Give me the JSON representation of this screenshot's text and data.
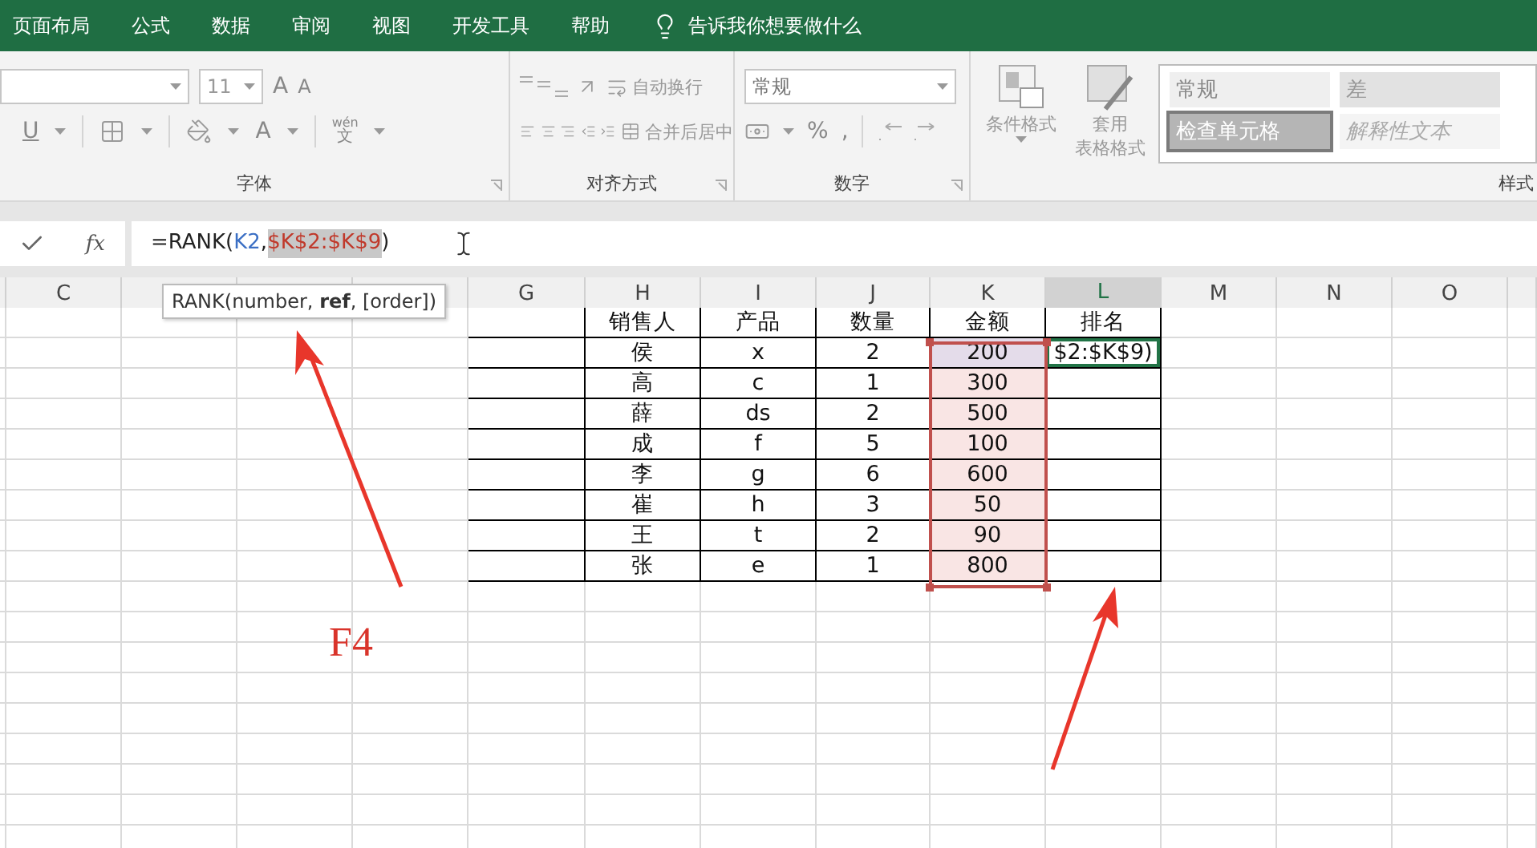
{
  "menu_tabs": [
    "页面布局",
    "公式",
    "数据",
    "审阅",
    "视图",
    "开发工具",
    "帮助"
  ],
  "tell_me": "告诉我你想要做什么",
  "ribbon": {
    "font": {
      "size": "11",
      "grow": "A",
      "shrink": "A",
      "underline": "U",
      "font_color_letter": "A",
      "phonetic_top": "wén",
      "phonetic_bottom": "文",
      "label": "字体"
    },
    "alignment": {
      "wrap": "自动换行",
      "merge": "合并后居中",
      "label": "对齐方式"
    },
    "number": {
      "format": "常规",
      "percent": "%",
      "comma": ",",
      "label": "数字"
    },
    "styles": {
      "conditional": "条件格式",
      "table_top": "套用",
      "table_bottom": "表格格式",
      "label": "样式",
      "gallery": [
        {
          "label": "常规",
          "kind": "normal"
        },
        {
          "label": "差",
          "kind": "bad"
        },
        {
          "label": "检查单元格",
          "kind": "check"
        },
        {
          "label": "解释性文本",
          "kind": "explanatory"
        }
      ]
    }
  },
  "formula_bar": {
    "insert_function": "fx",
    "parts": [
      {
        "text": "=RANK(",
        "kind": "plain",
        "selected": false
      },
      {
        "text": "K2",
        "kind": "ref",
        "color": "#3b6fc4",
        "selected": false,
        "suffix": ","
      },
      {
        "text": "$K$2:$K$9",
        "kind": "ref",
        "color": "#c0392b",
        "selected": true
      },
      {
        "text": ")",
        "kind": "plain",
        "selected": false
      }
    ]
  },
  "tooltip": "RANK(number, **ref**, [order])",
  "columns": [
    {
      "selected": false
    },
    {
      "letter": "C",
      "selected": false
    },
    {
      "selected": false
    },
    {
      "selected": false
    },
    {
      "selected": false
    },
    {
      "letter": "G",
      "selected": false
    },
    {
      "letter": "H",
      "selected": false
    },
    {
      "letter": "I",
      "selected": false
    },
    {
      "letter": "J",
      "selected": false
    },
    {
      "letter": "K",
      "selected": false
    },
    {
      "letter": "L",
      "selected": true
    },
    {
      "letter": "M",
      "selected": false
    },
    {
      "letter": "N",
      "selected": false
    },
    {
      "letter": "O",
      "selected": false
    },
    {
      "selected": false
    }
  ],
  "table": {
    "headers": [
      "销售人",
      "产品",
      "数量",
      "金额",
      "排名"
    ],
    "rows": [
      {
        "values": [
          "侯",
          "x",
          "2",
          "200",
          "$2:$K$9)"
        ],
        "in_range": true,
        "active": true
      },
      {
        "values": [
          "高",
          "c",
          "1",
          "300"
        ],
        "in_range": true,
        "active": false
      },
      {
        "values": [
          "薛",
          "ds",
          "2",
          "500"
        ],
        "in_range": true,
        "active": false
      },
      {
        "values": [
          "成",
          "f",
          "5",
          "100"
        ],
        "in_range": true,
        "active": false
      },
      {
        "values": [
          "李",
          "g",
          "6",
          "600"
        ],
        "in_range": true,
        "active": false
      },
      {
        "values": [
          "崔",
          "h",
          "3",
          "50"
        ],
        "in_range": true,
        "active": false
      },
      {
        "values": [
          "王",
          "t",
          "2",
          "90"
        ],
        "in_range": true,
        "active": false
      },
      {
        "values": [
          "张",
          "e",
          "1",
          "800"
        ],
        "in_range": true,
        "active": false
      }
    ]
  },
  "annotation": {
    "label": "F4"
  }
}
